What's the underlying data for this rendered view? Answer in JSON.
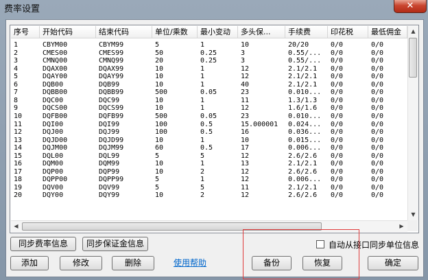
{
  "window": {
    "title": "费率设置",
    "close_glyph": "✕"
  },
  "table": {
    "columns": [
      "序号",
      "开始代码",
      "结束代码",
      "单位/乘数",
      "最小变动",
      "多头保...",
      "手续费",
      "印花税",
      "最低佣金"
    ],
    "rows": [
      [
        "1",
        "CBYM00",
        "CBYM99",
        "5",
        "1",
        "10",
        "20/20",
        "0/0",
        "0/0"
      ],
      [
        "2",
        "CMES00",
        "CMES99",
        "50",
        "0.25",
        "3",
        "0.55/...",
        "0/0",
        "0/0"
      ],
      [
        "3",
        "CMNQ00",
        "CMNQ99",
        "20",
        "0.25",
        "3",
        "0.55/...",
        "0/0",
        "0/0"
      ],
      [
        "4",
        "DQAX00",
        "DQAX99",
        "10",
        "1",
        "12",
        "2.1/2.1",
        "0/0",
        "0/0"
      ],
      [
        "5",
        "DQAY00",
        "DQAY99",
        "10",
        "1",
        "12",
        "2.1/2.1",
        "0/0",
        "0/0"
      ],
      [
        "6",
        "DQB00",
        "DQB99",
        "10",
        "1",
        "40",
        "2.1/2.1",
        "0/0",
        "0/0"
      ],
      [
        "7",
        "DQBB00",
        "DQBB99",
        "500",
        "0.05",
        "23",
        "0.010...",
        "0/0",
        "0/0"
      ],
      [
        "8",
        "DQC00",
        "DQC99",
        "10",
        "1",
        "11",
        "1.3/1.3",
        "0/0",
        "0/0"
      ],
      [
        "9",
        "DQCS00",
        "DQCS99",
        "10",
        "1",
        "12",
        "1.6/1.6",
        "0/0",
        "0/0"
      ],
      [
        "10",
        "DQFB00",
        "DQFB99",
        "500",
        "0.05",
        "23",
        "0.010...",
        "0/0",
        "0/0"
      ],
      [
        "11",
        "DQI00",
        "DQI99",
        "100",
        "0.5",
        "15.000001",
        "0.024...",
        "0/0",
        "0/0"
      ],
      [
        "12",
        "DQJ00",
        "DQJ99",
        "100",
        "0.5",
        "16",
        "0.036...",
        "0/0",
        "0/0"
      ],
      [
        "13",
        "DQJD00",
        "DQJD99",
        "10",
        "1",
        "10",
        "0.015...",
        "0/0",
        "0/0"
      ],
      [
        "14",
        "DQJM00",
        "DQJM99",
        "60",
        "0.5",
        "17",
        "0.006...",
        "0/0",
        "0/0"
      ],
      [
        "15",
        "DQL00",
        "DQL99",
        "5",
        "5",
        "12",
        "2.6/2.6",
        "0/0",
        "0/0"
      ],
      [
        "16",
        "DQM00",
        "DQM99",
        "10",
        "1",
        "13",
        "2.1/2.1",
        "0/0",
        "0/0"
      ],
      [
        "17",
        "DQP00",
        "DQP99",
        "10",
        "2",
        "12",
        "2.6/2.6",
        "0/0",
        "0/0"
      ],
      [
        "18",
        "DQPP00",
        "DQPP99",
        "5",
        "1",
        "12",
        "0.006...",
        "0/0",
        "0/0"
      ],
      [
        "19",
        "DQV00",
        "DQV99",
        "5",
        "5",
        "11",
        "2.1/2.1",
        "0/0",
        "0/0"
      ],
      [
        "20",
        "DQY00",
        "DQY99",
        "10",
        "2",
        "12",
        "2.6/2.6",
        "0/0",
        "0/0"
      ]
    ]
  },
  "buttons": {
    "sync_rate": "同步费率信息",
    "sync_margin": "同步保证金信息",
    "add": "添加",
    "edit": "修改",
    "delete": "删除",
    "help": "使用帮助",
    "backup": "备份",
    "restore": "恢复",
    "ok": "确定"
  },
  "options": {
    "auto_sync_label": "自动从接口同步单位信息",
    "auto_sync_checked": false
  },
  "icons": {
    "scroll_up": "▲",
    "scroll_down": "▼",
    "scroll_left": "◀",
    "scroll_right": "▶"
  },
  "colors": {
    "highlight_box": "#e03a3a",
    "link": "#0066cc"
  }
}
